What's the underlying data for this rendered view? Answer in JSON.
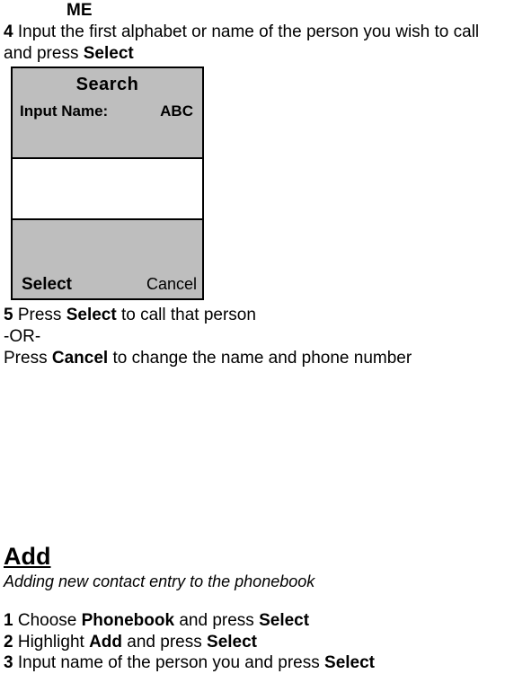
{
  "header": {
    "me": "ME",
    "step4": {
      "num": "4",
      "textPrefix": " Input the first alphabet or name of the person you wish to call and press ",
      "bold": "Select"
    }
  },
  "phone": {
    "title": "Search",
    "inputLabel": "Input Name:",
    "mode": "ABC",
    "softkeyLeft": "Select",
    "softkeyRight": "Cancel"
  },
  "step5": {
    "num": "5",
    "textPrefix": " Press ",
    "bold1": "Select",
    "textMid": " to call that person"
  },
  "orText": "-OR-",
  "step5b": {
    "textPrefix": "Press ",
    "bold": "Cancel",
    "textSuffix": " to change the name and phone number"
  },
  "add": {
    "heading": "Add",
    "sub": "Adding new contact entry to the phonebook",
    "step1": {
      "num": "1",
      "t1": " Choose ",
      "b1": "Phonebook",
      "t2": " and press ",
      "b2": "Select"
    },
    "step2": {
      "num": "2",
      "t1": " Highlight ",
      "b1": "Add",
      "t2": " and press ",
      "b2": "Select"
    },
    "step3": {
      "num": "3",
      "t1": " Input name of the person you and press ",
      "b1": "Select"
    }
  }
}
